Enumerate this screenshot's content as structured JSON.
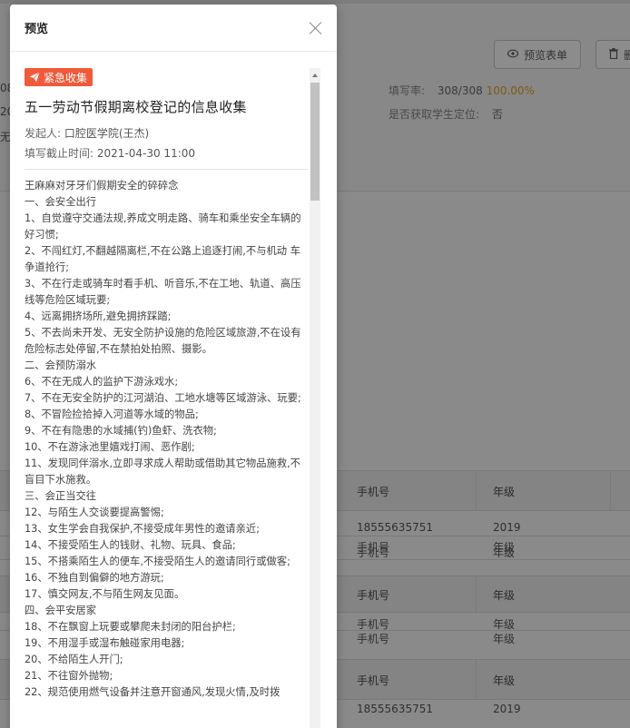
{
  "background": {
    "buttons": {
      "preview_form": "预览表单",
      "second_partial": "删"
    },
    "stats": {
      "fill_rate_label": "填写率:",
      "fill_rate_value": "308/308",
      "fill_rate_percent": "100.00%",
      "location_label": "是否获取学生定位:",
      "location_value": "否"
    },
    "left_edge": [
      "08",
      "20",
      "无"
    ],
    "tables": [
      {
        "headers": [
          "手机号",
          "年级"
        ],
        "rows": [
          [
            "18555635751",
            "2019"
          ],
          [
            "手机号",
            "年级"
          ],
          [
            "手机号",
            "年级"
          ]
        ]
      },
      {
        "headers": [
          "手机号",
          "年级"
        ],
        "rows": [
          [
            "手机号",
            "年级"
          ],
          [
            "手机号",
            "年级"
          ]
        ]
      },
      {
        "headers": [
          "手机号",
          "年级"
        ],
        "rows": [
          [
            "18555635751",
            "2019"
          ]
        ]
      }
    ]
  },
  "modal": {
    "title": "预览",
    "tag_label": "紧急收集",
    "form_title": "五一劳动节假期离校登记的信息收集",
    "initiator_label": "发起人:",
    "initiator_value": "口腔医学院(王杰)",
    "deadline_label": "填写截止时间:",
    "deadline_value": "2021-04-30 11:00",
    "description_lines": [
      "王麻麻对牙牙们假期安全的碎碎念",
      "一、会安全出行",
      "1、自觉遵守交通法规,养成文明走路、骑车和乘坐安全车辆的 好习惯;",
      "2、不闯红灯,不翻越隔离栏,不在公路上追逐打闹,不与机动 车争道抢行;",
      "3、不在行走或骑车时看手机、听音乐,不在工地、轨道、高压 线等危险区域玩要;",
      "4、远离拥挤场所,避免拥挤踩踏;",
      "5、不去尚未开发、无安全防护设施的危险区域旅游,不在设有 危险标志处停留,不在禁拍处拍照、摄影。",
      "二、会预防溺水",
      "6、不在无成人的监护下游泳戏水;",
      "7、不在无安全防护的江河湖泊、工地水塘等区域游泳、玩要;",
      "8、不冒险捡拾掉入河道等水域的物品;",
      "9、不在有隐患的水域捕(钓)鱼虾、洗衣物;",
      "10、不在游泳池里嬉戏打闹、恶作剧;",
      "11、发现同伴溺水,立即寻求成人帮助或借助其它物品施救,不 盲目下水施救。",
      "三、会正当交往",
      "12、与陌生人交谈要提高警惕;",
      "13、女生学会自我保护,不接受成年男性的邀请亲近;",
      "14、不接受陌生人的钱财、礼物、玩具、食品;",
      "15、不搭乘陌生人的便车,不接受陌生人的邀请同行或做客;",
      "16、不独自到偏僻的地方游玩;",
      "17、慎交网友,不与陌生网友见面。",
      "四、会平安居家",
      "18、不在飘窗上玩要或攀爬未封闭的阳台护栏;",
      "19、不用湿手或湿布触碰家用电器;",
      "20、不给陌生人开门;",
      "21、不往窗外抛物;",
      "22、规范使用燃气设备并注意开窗通风,发现火情,及时拨"
    ]
  },
  "colors": {
    "tag_bg": "#f05a3a",
    "overlay": "#8a8a8a"
  }
}
